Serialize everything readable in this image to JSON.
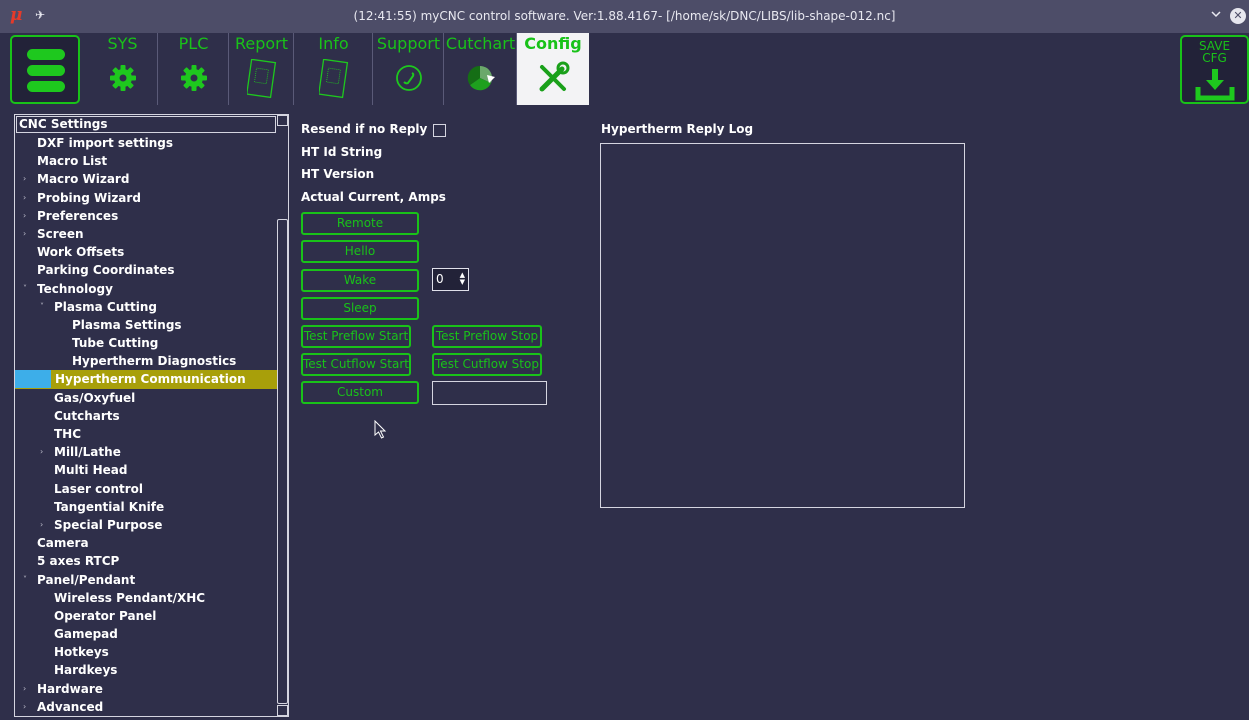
{
  "window": {
    "title": "(12:41:55) myCNC control software. Ver:1.88.4167- [/home/sk/DNC/LIBS/lib-shape-012.nc]",
    "app_icon": "μ"
  },
  "toolbar": {
    "tabs": [
      {
        "label": "SYS",
        "icon": "gear-icon"
      },
      {
        "label": "PLC",
        "icon": "gear-icon"
      },
      {
        "label": "Report",
        "icon": "document-icon"
      },
      {
        "label": "Info",
        "icon": "document-icon"
      },
      {
        "label": "Support",
        "icon": "phone-icon"
      },
      {
        "label": "Cutchart",
        "icon": "pie-icon"
      },
      {
        "label": "Config",
        "icon": "tools-icon"
      }
    ],
    "save_label_line1": "SAVE",
    "save_label_line2": "CFG",
    "accent_color": "#19c219"
  },
  "tree": {
    "header": "CNC Settings",
    "items": [
      {
        "label": "DXF import settings",
        "level": 1,
        "arrow": ""
      },
      {
        "label": "Macro List",
        "level": 1,
        "arrow": ""
      },
      {
        "label": "Macro Wizard",
        "level": 1,
        "arrow": "›"
      },
      {
        "label": "Probing Wizard",
        "level": 1,
        "arrow": "›"
      },
      {
        "label": "Preferences",
        "level": 1,
        "arrow": "›"
      },
      {
        "label": "Screen",
        "level": 1,
        "arrow": "›"
      },
      {
        "label": "Work Offsets",
        "level": 1,
        "arrow": ""
      },
      {
        "label": "Parking Coordinates",
        "level": 1,
        "arrow": ""
      },
      {
        "label": "Technology",
        "level": 1,
        "arrow": "˅"
      },
      {
        "label": "Plasma Cutting",
        "level": 2,
        "arrow": "˅"
      },
      {
        "label": "Plasma Settings",
        "level": 3,
        "arrow": ""
      },
      {
        "label": "Tube Cutting",
        "level": 3,
        "arrow": ""
      },
      {
        "label": "Hypertherm Diagnostics",
        "level": 3,
        "arrow": ""
      },
      {
        "label": "Hypertherm Communication",
        "level": 3,
        "arrow": "",
        "selected": true
      },
      {
        "label": "Gas/Oxyfuel",
        "level": 2,
        "arrow": ""
      },
      {
        "label": "Cutcharts",
        "level": 2,
        "arrow": ""
      },
      {
        "label": "THC",
        "level": 2,
        "arrow": ""
      },
      {
        "label": "Mill/Lathe",
        "level": 2,
        "arrow": "›"
      },
      {
        "label": "Multi Head",
        "level": 2,
        "arrow": ""
      },
      {
        "label": "Laser control",
        "level": 2,
        "arrow": ""
      },
      {
        "label": "Tangential Knife",
        "level": 2,
        "arrow": ""
      },
      {
        "label": "Special Purpose",
        "level": 2,
        "arrow": "›"
      },
      {
        "label": "Camera",
        "level": 1,
        "arrow": ""
      },
      {
        "label": "5 axes RTCP",
        "level": 1,
        "arrow": ""
      },
      {
        "label": "Panel/Pendant",
        "level": 1,
        "arrow": "˅"
      },
      {
        "label": "Wireless Pendant/XHC",
        "level": 2,
        "arrow": ""
      },
      {
        "label": "Operator Panel",
        "level": 2,
        "arrow": ""
      },
      {
        "label": "Gamepad",
        "level": 2,
        "arrow": ""
      },
      {
        "label": "Hotkeys",
        "level": 2,
        "arrow": ""
      },
      {
        "label": "Hardkeys",
        "level": 2,
        "arrow": ""
      },
      {
        "label": "Hardware",
        "level": 1,
        "arrow": "›"
      },
      {
        "label": "Advanced",
        "level": 1,
        "arrow": "›"
      }
    ]
  },
  "form": {
    "resend_label": "Resend if no Reply",
    "resend_checked": false,
    "ht_id_label": "HT Id String",
    "ht_version_label": "HT Version",
    "current_label": "Actual Current, Amps",
    "buttons": {
      "remote": "Remote",
      "hello": "Hello",
      "wake": "Wake",
      "sleep": "Sleep",
      "preflow_start": "Test Preflow Start",
      "preflow_stop": "Test Preflow Stop",
      "cutflow_start": "Test Cutflow Start",
      "cutflow_stop": "Test Cutflow Stop",
      "custom": "Custom"
    },
    "wake_value": "0",
    "custom_value": ""
  },
  "log": {
    "label": "Hypertherm Reply Log"
  }
}
